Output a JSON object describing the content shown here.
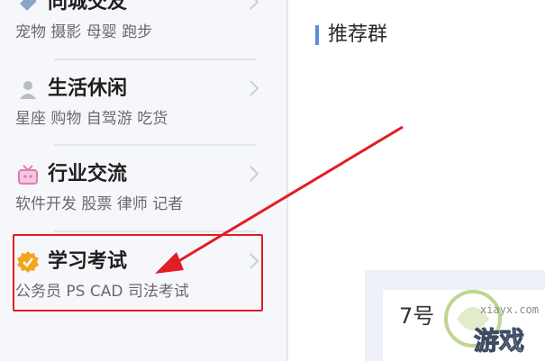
{
  "sidebar": {
    "categories": [
      {
        "title": "同城交友",
        "subtitle": "宠物 摄影 母婴 跑步",
        "icon": "tag-icon"
      },
      {
        "title": "生活休闲",
        "subtitle": "星座 购物 自驾游 吃货",
        "icon": "person-icon"
      },
      {
        "title": "行业交流",
        "subtitle": "软件开发 股票 律师 记者",
        "icon": "tv-icon"
      },
      {
        "title": "学习考试",
        "subtitle": "公务员 PS CAD 司法考试",
        "icon": "check-badge-icon"
      }
    ]
  },
  "main": {
    "section_title": "推荐群",
    "card_text": "7号"
  },
  "annotation": {
    "highlight_color": "#e21d24",
    "arrow_color": "#e21d24"
  },
  "watermark": {
    "url": "xiayx.com",
    "brand": "游戏"
  }
}
